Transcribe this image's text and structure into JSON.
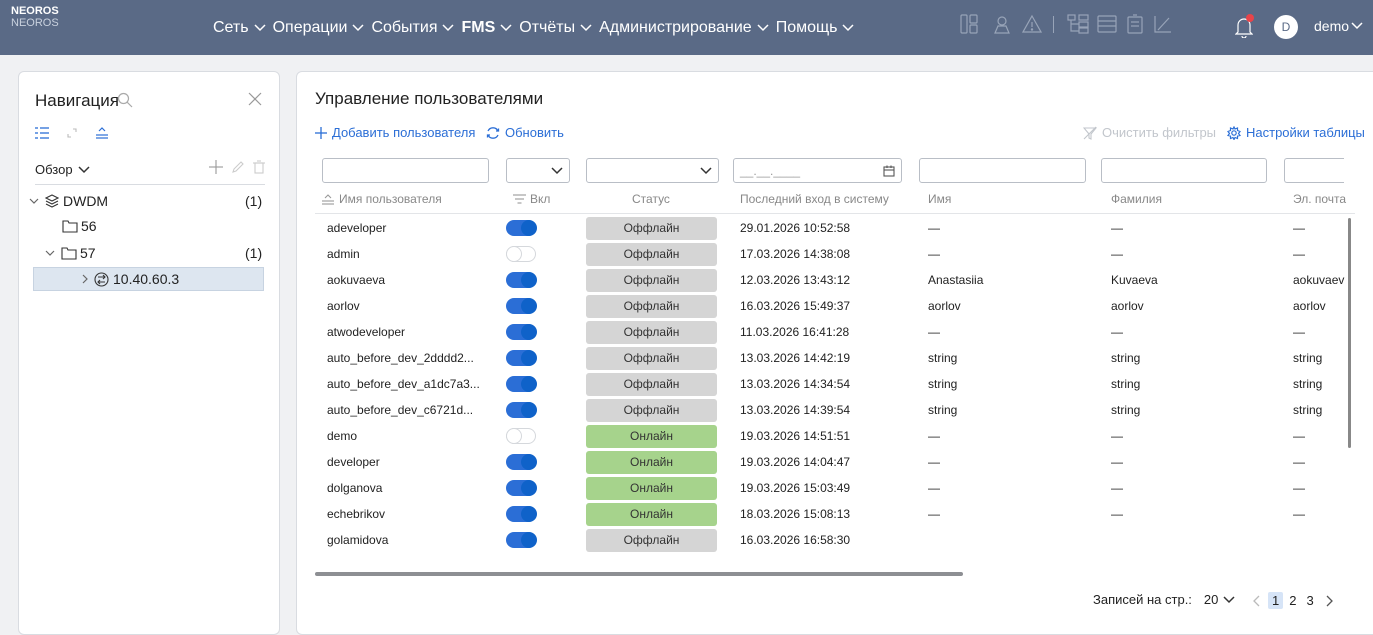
{
  "brand": {
    "name": "NEOROS",
    "sub": "NEOROS"
  },
  "menu": [
    {
      "label": "Сеть",
      "active": false
    },
    {
      "label": "Операции",
      "active": false
    },
    {
      "label": "События",
      "active": false
    },
    {
      "label": "FMS",
      "active": true
    },
    {
      "label": "Отчёты",
      "active": false
    },
    {
      "label": "Администрирование",
      "active": false
    },
    {
      "label": "Помощь",
      "active": false
    }
  ],
  "top_icons": [
    "layout-icon",
    "map-pin-icon",
    "warning-icon",
    "tree-icon",
    "list-icon",
    "note-icon",
    "chart-icon"
  ],
  "user": {
    "initial": "D",
    "name": "demo"
  },
  "nav": {
    "title": "Навигация",
    "overview": "Обзор",
    "tree": [
      {
        "label": "DWDM",
        "count": "(1)"
      },
      {
        "label": "56",
        "count": ""
      },
      {
        "label": "57",
        "count": "(1)"
      },
      {
        "label": "10.40.60.3",
        "count": ""
      }
    ]
  },
  "main": {
    "title": "Управление пользователями",
    "add_user": "Добавить пользователя",
    "refresh": "Обновить",
    "clear_filters": "Очистить фильтры",
    "table_settings": "Настройки таблицы",
    "date_placeholder": "__.__.____",
    "columns": {
      "username": "Имя пользователя",
      "enabled": "Вкл",
      "status": "Статус",
      "last_login": "Последний вход в систему",
      "first_name": "Имя",
      "last_name": "Фамилия",
      "email": "Эл. почта"
    },
    "rows": [
      {
        "username": "adeveloper",
        "enabled": true,
        "status": "Оффлайн",
        "online": false,
        "last_login": "29.01.2026 10:52:58",
        "first_name": "—",
        "last_name": "—",
        "email": "—"
      },
      {
        "username": "admin",
        "enabled": false,
        "status": "Оффлайн",
        "online": false,
        "last_login": "17.03.2026 14:38:08",
        "first_name": "—",
        "last_name": "—",
        "email": "—"
      },
      {
        "username": "aokuvaeva",
        "enabled": true,
        "status": "Оффлайн",
        "online": false,
        "last_login": "12.03.2026 13:43:12",
        "first_name": "Anastasiia",
        "last_name": "Kuvaeva",
        "email": "aokuvaev"
      },
      {
        "username": "aorlov",
        "enabled": true,
        "status": "Оффлайн",
        "online": false,
        "last_login": "16.03.2026 15:49:37",
        "first_name": "aorlov",
        "last_name": "aorlov",
        "email": "aorlov"
      },
      {
        "username": "atwodeveloper",
        "enabled": true,
        "status": "Оффлайн",
        "online": false,
        "last_login": "11.03.2026 16:41:28",
        "first_name": "—",
        "last_name": "—",
        "email": "—"
      },
      {
        "username": "auto_before_dev_2dddd2...",
        "enabled": true,
        "status": "Оффлайн",
        "online": false,
        "last_login": "13.03.2026 14:42:19",
        "first_name": "string",
        "last_name": "string",
        "email": "string"
      },
      {
        "username": "auto_before_dev_a1dc7a3...",
        "enabled": true,
        "status": "Оффлайн",
        "online": false,
        "last_login": "13.03.2026 14:34:54",
        "first_name": "string",
        "last_name": "string",
        "email": "string"
      },
      {
        "username": "auto_before_dev_c6721d...",
        "enabled": true,
        "status": "Оффлайн",
        "online": false,
        "last_login": "13.03.2026 14:39:54",
        "first_name": "string",
        "last_name": "string",
        "email": "string"
      },
      {
        "username": "demo",
        "enabled": false,
        "status": "Онлайн",
        "online": true,
        "last_login": "19.03.2026 14:51:51",
        "first_name": "—",
        "last_name": "—",
        "email": "—"
      },
      {
        "username": "developer",
        "enabled": true,
        "status": "Онлайн",
        "online": true,
        "last_login": "19.03.2026 14:04:47",
        "first_name": "—",
        "last_name": "—",
        "email": "—"
      },
      {
        "username": "dolganova",
        "enabled": true,
        "status": "Онлайн",
        "online": true,
        "last_login": "19.03.2026 15:03:49",
        "first_name": "—",
        "last_name": "—",
        "email": "—"
      },
      {
        "username": "echebrikov",
        "enabled": true,
        "status": "Онлайн",
        "online": true,
        "last_login": "18.03.2026 15:08:13",
        "first_name": "—",
        "last_name": "—",
        "email": "—"
      },
      {
        "username": "golamidova",
        "enabled": true,
        "status": "Оффлайн",
        "online": false,
        "last_login": "16.03.2026 16:58:30",
        "first_name": "",
        "last_name": "",
        "email": ""
      }
    ],
    "pager": {
      "label": "Записей на стр.:",
      "size": "20",
      "pages": [
        "1",
        "2",
        "3"
      ],
      "current": "1"
    }
  },
  "colors": {
    "topbar": "#5a6a86",
    "accent": "#2b6ed6",
    "online": "#a6d38c",
    "offline": "#d5d5d5"
  }
}
